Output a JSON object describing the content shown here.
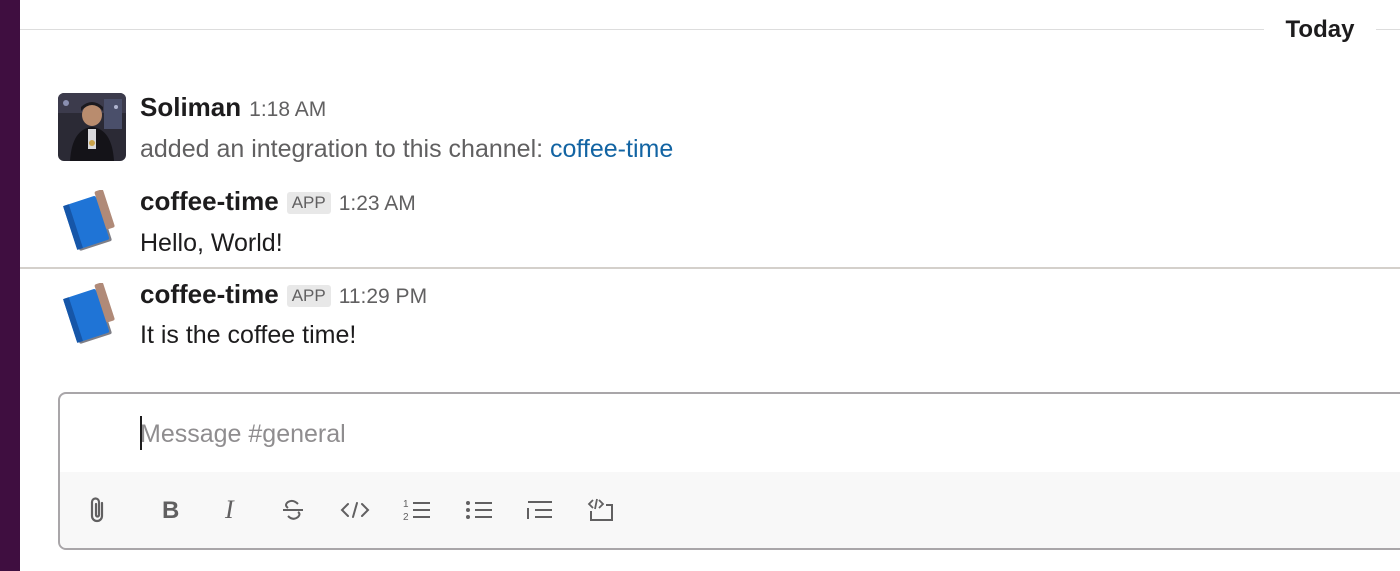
{
  "divider": {
    "date_label": "Today"
  },
  "messages": [
    {
      "sender": "Soliman",
      "time": "1:18 AM",
      "text_prefix": "added an integration to this channel: ",
      "link_text": "coffee-time",
      "avatar_icon": "user-photo"
    },
    {
      "sender": "coffee-time",
      "badge": "APP",
      "time": "1:23 AM",
      "text": "Hello, World!",
      "avatar_icon": "notebook-icon"
    },
    {
      "sender": "coffee-time",
      "badge": "APP",
      "time": "11:29 PM",
      "text": "It is the coffee time!",
      "avatar_icon": "notebook-icon"
    }
  ],
  "composer": {
    "placeholder": "Message #general",
    "toolbar": [
      "attach-icon",
      "bold-icon",
      "italic-icon",
      "strikethrough-icon",
      "code-icon",
      "ordered-list-icon",
      "bulleted-list-icon",
      "blockquote-icon",
      "code-block-icon"
    ]
  },
  "colors": {
    "sidebar": "#3f0e40",
    "link": "#1264a3",
    "text": "#1d1c1d",
    "muted": "#616061"
  }
}
